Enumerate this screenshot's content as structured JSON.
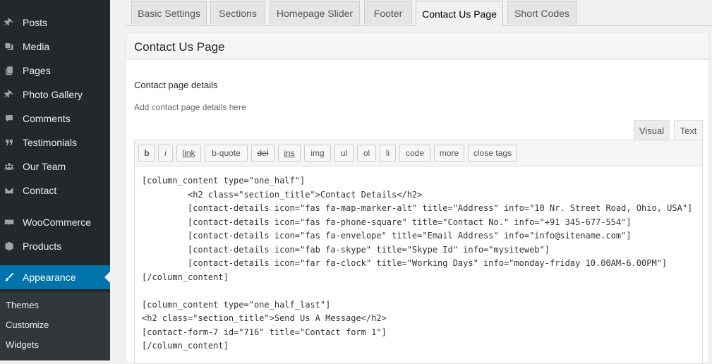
{
  "sidebar": {
    "items": [
      {
        "label": "Posts",
        "icon": "pin-icon"
      },
      {
        "label": "Media",
        "icon": "media-icon"
      },
      {
        "label": "Pages",
        "icon": "pages-icon"
      },
      {
        "label": "Photo Gallery",
        "icon": "pin-icon"
      },
      {
        "label": "Comments",
        "icon": "comment-icon"
      },
      {
        "label": "Testimonials",
        "icon": "quote-icon"
      },
      {
        "label": "Our Team",
        "icon": "team-icon"
      },
      {
        "label": "Contact",
        "icon": "envelope-icon"
      },
      {
        "label": "WooCommerce",
        "icon": "woo-icon"
      },
      {
        "label": "Products",
        "icon": "box-icon"
      },
      {
        "label": "Appearance",
        "icon": "brush-icon",
        "active": true
      }
    ],
    "submenu": [
      "Themes",
      "Customize",
      "Widgets"
    ],
    "colors": {
      "bg": "#23282d",
      "active": "#0073aa"
    }
  },
  "tabs": [
    "Basic Settings",
    "Sections",
    "Homepage Slider",
    "Footer",
    "Contact Us Page",
    "Short Codes"
  ],
  "active_tab": "Contact Us Page",
  "panel": {
    "title": "Contact Us Page",
    "field_label": "Contact page details",
    "field_desc": "Add contact page details here"
  },
  "editor": {
    "mode_tabs": [
      "Visual",
      "Text"
    ],
    "active_mode": "Text",
    "quicktags": [
      "b",
      "i",
      "link",
      "b-quote",
      "del",
      "ins",
      "img",
      "ul",
      "ol",
      "li",
      "code",
      "more",
      "close tags"
    ],
    "lines": [
      "[column_content type=\"one_half\"]",
      "\t<h2 class=\"section_title\">Contact Details</h2>",
      "\t[contact-details icon=\"fas fa-map-marker-alt\" title=\"Address\" info=\"10 Nr. Street Road, Ohio, USA\"]",
      "\t[contact-details icon=\"fas fa-phone-square\" title=\"Contact No.\" info=\"+91 345-677-554\"]",
      "\t[contact-details icon=\"fas fa-envelope\" title=\"Email Address\" info=\"info@sitename.com\"]",
      "\t[contact-details icon=\"fab fa-skype\" title=\"Skype Id\" info=\"mysiteweb\"]",
      "\t[contact-details icon=\"far fa-clock\" title=\"Working Days\" info=\"monday-friday 10.00AM-6.00PM\"]",
      "[/column_content]",
      "",
      "[column_content type=\"one_half_last\"]",
      "<h2 class=\"section_title\">Send Us A Message</h2>",
      "[contact-form-7 id=\"716\" title=\"Contact form 1\"]",
      "[/column_content]"
    ]
  }
}
